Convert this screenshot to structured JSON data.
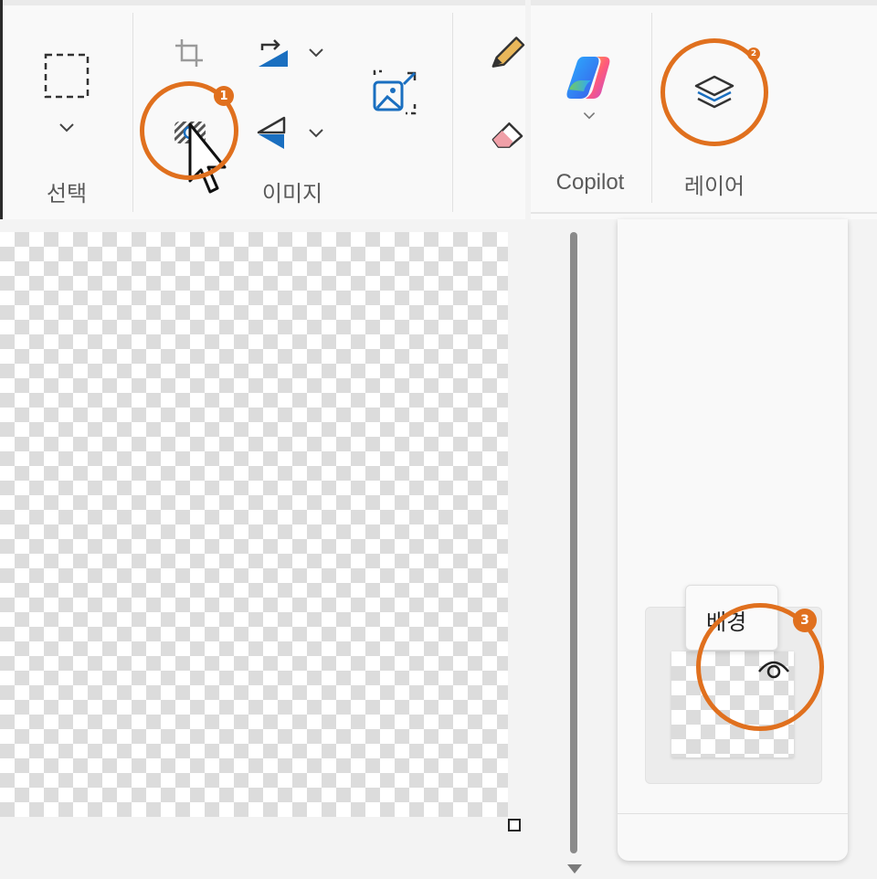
{
  "ribbon": {
    "select_group": {
      "label": "선택"
    },
    "image_group": {
      "label": "이미지"
    },
    "copilot_group": {
      "label": "Copilot"
    },
    "layers_group": {
      "label": "레이어"
    }
  },
  "annotations": {
    "step1": "1",
    "step2": "2",
    "step3": "3",
    "ring_color": "#e0701e"
  },
  "layers_panel": {
    "layer_tooltip": "배경"
  },
  "icons": {
    "select": "rectangle-select-icon",
    "crop": "crop-icon",
    "remove_background": "remove-background-icon",
    "rotate": "rotate-icon",
    "flip": "flip-icon",
    "resize": "resize-image-icon",
    "pencil": "pencil-icon",
    "eraser": "eraser-icon",
    "copilot": "copilot-icon",
    "layers": "layers-icon",
    "visibility": "eye-icon"
  }
}
